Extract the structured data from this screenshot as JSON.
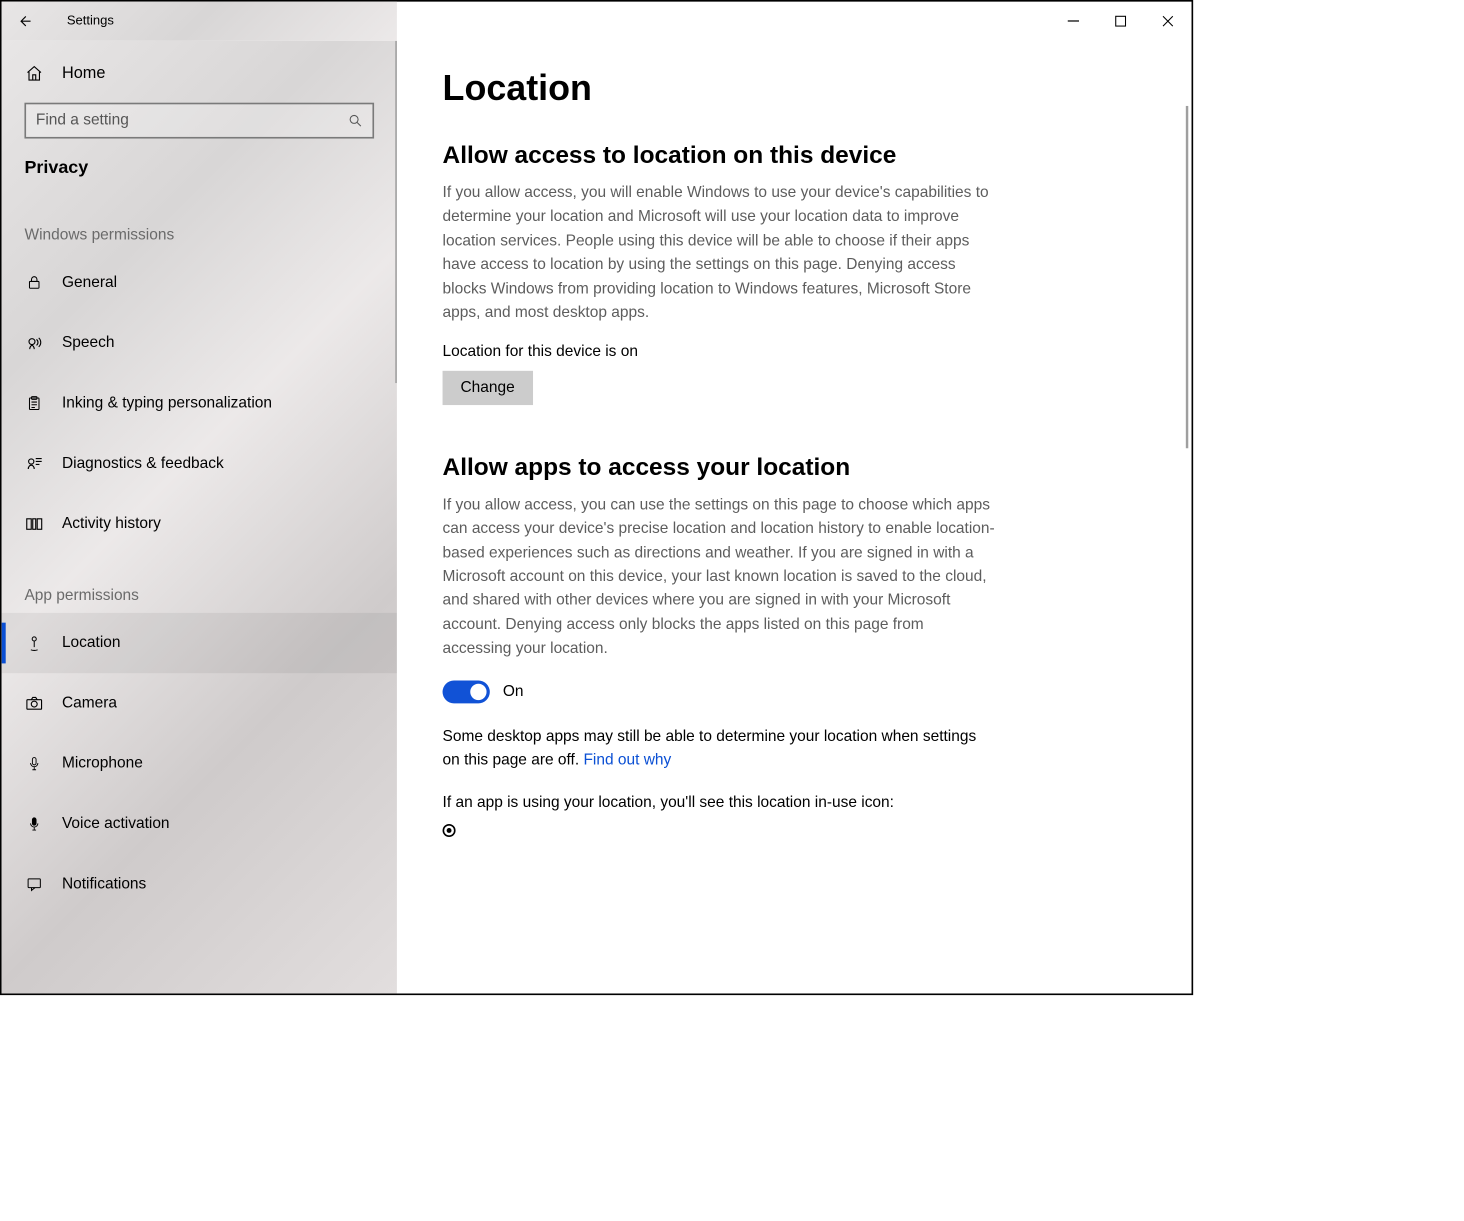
{
  "window": {
    "title": "Settings"
  },
  "sidebar": {
    "home_label": "Home",
    "search_placeholder": "Find a setting",
    "category_label": "Privacy",
    "group1_label": "Windows permissions",
    "group1_items": [
      {
        "label": "General"
      },
      {
        "label": "Speech"
      },
      {
        "label": "Inking & typing personalization"
      },
      {
        "label": "Diagnostics & feedback"
      },
      {
        "label": "Activity history"
      }
    ],
    "group2_label": "App permissions",
    "group2_items": [
      {
        "label": "Location"
      },
      {
        "label": "Camera"
      },
      {
        "label": "Microphone"
      },
      {
        "label": "Voice activation"
      },
      {
        "label": "Notifications"
      }
    ]
  },
  "main": {
    "page_title": "Location",
    "section1": {
      "title": "Allow access to location on this device",
      "body": "If you allow access, you will enable Windows to use your device's capabilities to determine your location and Microsoft will use your location data to improve location services. People using this device will be able to choose if their apps have access to location by using the settings on this page. Denying access blocks Windows from providing location to Windows features, Microsoft Store apps, and most desktop apps.",
      "status": "Location for this device is on",
      "change_button": "Change"
    },
    "section2": {
      "title": "Allow apps to access your location",
      "body": "If you allow access, you can use the settings on this page to choose which apps can access your device's precise location and location history to enable location-based experiences such as directions and weather. If you are signed in with a Microsoft account on this device, your last known location is saved to the cloud, and shared with other devices where you are signed in with your Microsoft account. Denying access only blocks the apps listed on this page from accessing your location.",
      "toggle_state": "On",
      "note_before_link": "Some desktop apps may still be able to determine your location when settings on this page are off. ",
      "note_link": "Find out why",
      "in_use_line": "If an app is using your location, you'll see this location in-use icon:"
    }
  }
}
